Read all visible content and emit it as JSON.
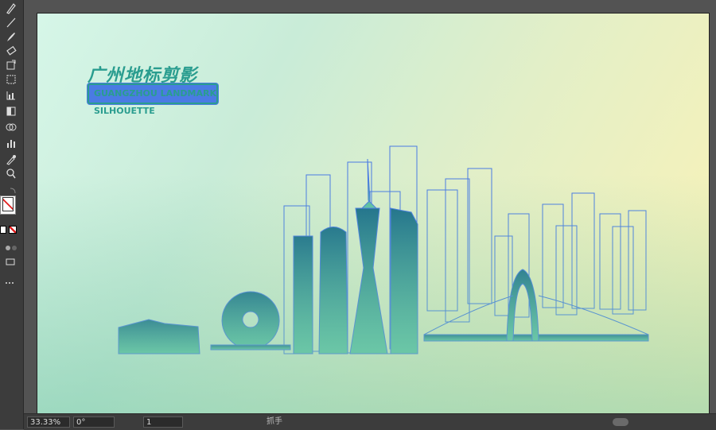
{
  "artboard": {
    "title": "广州地标剪影",
    "subtitle": "GUANGZHOU LANDMARK SILHOUETTE"
  },
  "colors": {
    "accent_teal": "#2a9d8f",
    "selection_blue": "#4a7be3",
    "bg_gradient_start": "#d6f6e8",
    "bg_gradient_end": "#fdf3b5"
  },
  "toolbar": {
    "tools": [
      "pen-icon",
      "line-icon",
      "brush-icon",
      "eraser-icon",
      "rotate-icon",
      "scale-icon",
      "graph-icon",
      "gradient-icon",
      "blend-icon",
      "chart-icon",
      "eyedropper-icon",
      "zoom-icon",
      "swap-colors-icon",
      "fill-stroke-icon",
      "screen-mode-icon"
    ]
  },
  "statusbar": {
    "zoom": "33.33%",
    "rotation": "0°",
    "artboard_number": "1",
    "tool_name": "抓手"
  }
}
